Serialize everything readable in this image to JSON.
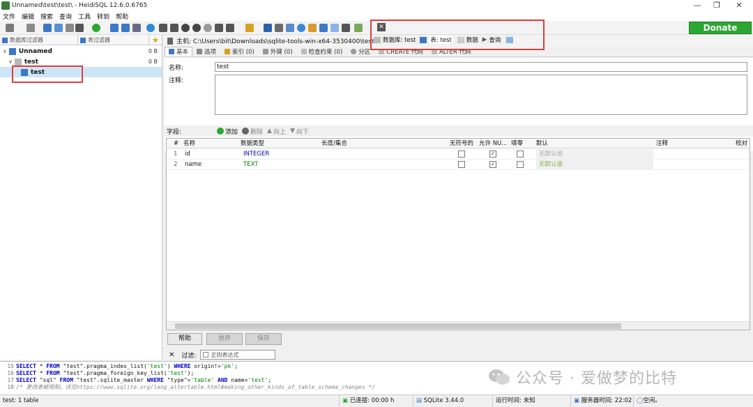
{
  "window": {
    "title": "Unnamed\\test\\test\\ - HeidiSQL 12.6.0.6765"
  },
  "menu": [
    "文件",
    "编辑",
    "搜索",
    "查询",
    "工具",
    "转到",
    "帮助"
  ],
  "donate_label": "Donate",
  "left": {
    "db_filter": "数据库过滤器",
    "table_filter": "表过滤器",
    "tree": [
      {
        "label": "Unnamed",
        "size": "0 B"
      },
      {
        "label": "test",
        "size": "0 B"
      },
      {
        "label": "test",
        "size": ""
      }
    ]
  },
  "host": {
    "label": "主机: C:\\Users\\bit\\Downloads\\sqlite-tools-win-x64-3530400\\test.db"
  },
  "top_tabs": {
    "database": "数据库: test",
    "table": "表: test",
    "data": "数据",
    "query": "查询"
  },
  "subtabs": [
    "基本",
    "选项",
    "索引 (0)",
    "外键 (0)",
    "检查约束 (0)",
    "分区",
    "CREATE 代码",
    "ALTER 代码"
  ],
  "form": {
    "name_label": "名称:",
    "name_value": "test",
    "comment_label": "注释:"
  },
  "fields": {
    "label": "字段:",
    "add": "添加",
    "delete": "删除",
    "up": "向上",
    "down": "向下"
  },
  "grid": {
    "headers": [
      "#",
      "名称",
      "数据类型",
      "长度/集合",
      "无符号的",
      "允许 NU...",
      "填零",
      "默认",
      "注释",
      "校对"
    ],
    "rows": [
      {
        "num": "1",
        "name": "id",
        "type": "INTEGER",
        "type_color": "#0000d0",
        "unsigned": false,
        "nullable": true,
        "zerofill": false,
        "default": "无默认值"
      },
      {
        "num": "2",
        "name": "name",
        "type": "TEXT",
        "type_color": "#008000",
        "unsigned": false,
        "nullable": true,
        "zerofill": false,
        "default": "无默认值"
      }
    ]
  },
  "buttons": {
    "help": "帮助",
    "discard": "放弃",
    "save": "保存"
  },
  "filter": {
    "label": "过滤:",
    "placeholder": "正则表达式"
  },
  "sql_log": [
    {
      "ln": "15",
      "text": "SELECT * FROM \"test\".pragma_index_list('test') WHERE origin!='pk';"
    },
    {
      "ln": "16",
      "text": "SELECT * FROM \"test\".pragma_foreign_key_list('test');"
    },
    {
      "ln": "17",
      "text": "SELECT \"sql\" FROM \"test\".sqlite_master WHERE \"type\"='table' AND name='test';"
    },
    {
      "ln": "18",
      "text": "/* 更改表被限制。详见https://www.sqlite.org/lang_altertable.html#making_other_kinds_of_table_schema_changes */"
    }
  ],
  "watermark": "公众号 · 爱做梦的比特",
  "status": {
    "table": "test: 1 table",
    "connected": "已连接: 00:00 h",
    "sqlite": "SQLite 3.44.0",
    "runtime": "运行时间: 未知",
    "server_time": "服务器时间: 22:02",
    "idle": "空闲。"
  }
}
